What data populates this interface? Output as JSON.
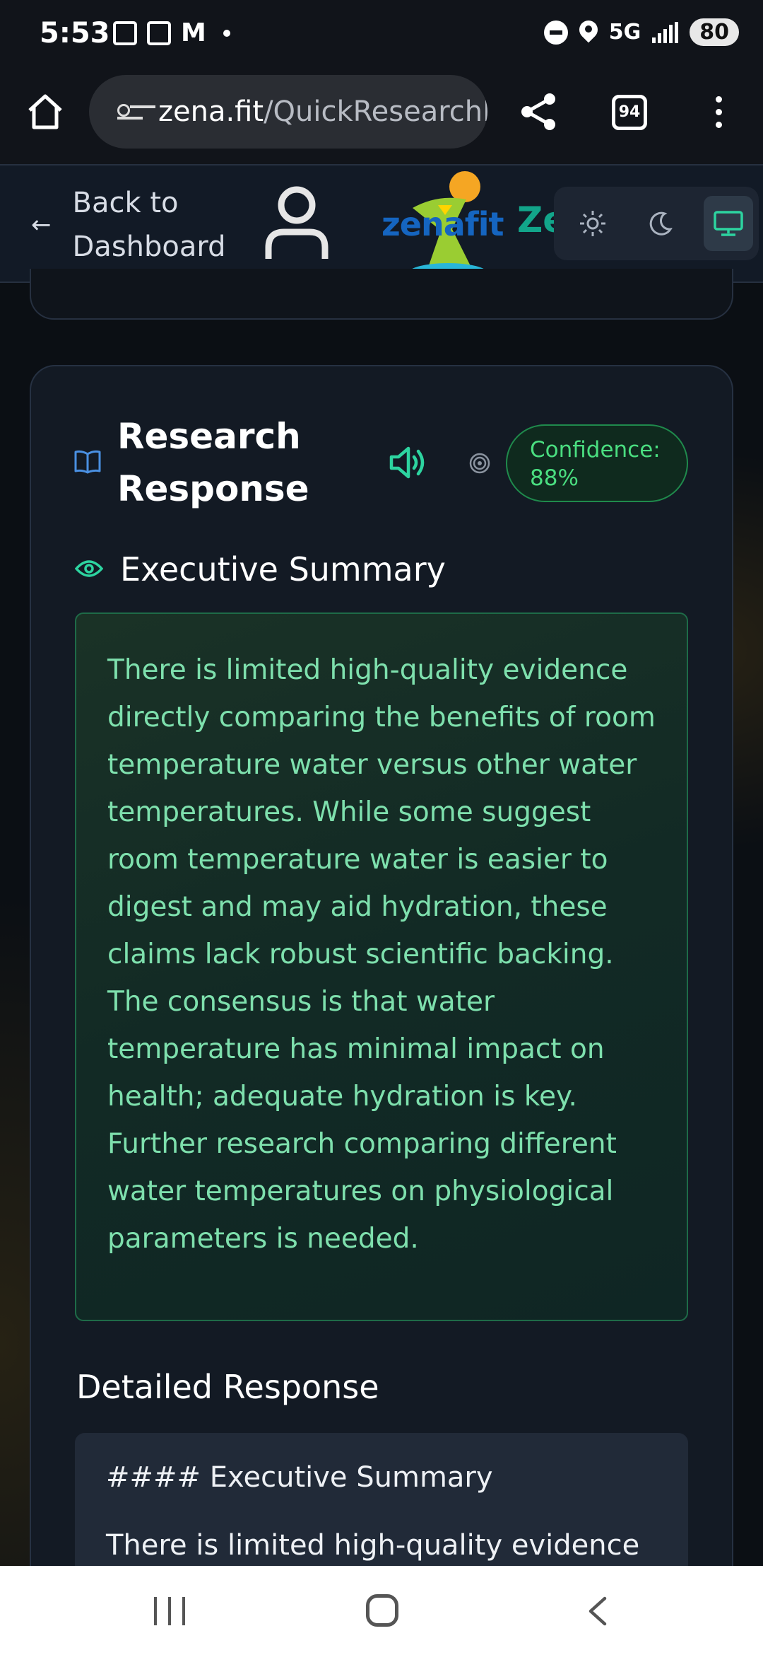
{
  "status_bar": {
    "time": "5:53",
    "network": "5G",
    "battery": "80"
  },
  "browser": {
    "url_domain": "zena.fit",
    "url_path": "/QuickResearchF",
    "tab_count": "94"
  },
  "header": {
    "back_label": "Back to Dashboard",
    "logo_text": "zenafit",
    "brand_partial": "Ze"
  },
  "card": {
    "title": "Research Response",
    "confidence": "Confidence: 88%",
    "exec_heading": "Executive Summary",
    "summary": "There is limited high-quality evidence directly comparing the benefits of room temperature water versus other water temperatures. While some suggest room temperature water is easier to digest and may aid hydration, these claims lack robust scientific backing. The consensus is that water temperature has minimal impact on health; adequate hydration is key. Further research comparing different water temperatures on physiological parameters is needed.",
    "detailed_heading": "Detailed Response",
    "detail_line1": "#### Executive Summary",
    "detail_line2": "There is limited high-quality evidence"
  },
  "colors": {
    "accent_green": "#4ade80",
    "summary_text": "#7ee0ad",
    "brand_teal": "#12a58a",
    "icon_blue": "#3b82f6"
  },
  "icons": [
    "home-icon",
    "tune-icon",
    "share-icon",
    "tabs-icon",
    "more-vert-icon",
    "back-arrow-icon",
    "user-icon",
    "sun-icon",
    "moon-icon",
    "monitor-icon",
    "book-icon",
    "speaker-icon",
    "target-icon",
    "eye-icon"
  ]
}
